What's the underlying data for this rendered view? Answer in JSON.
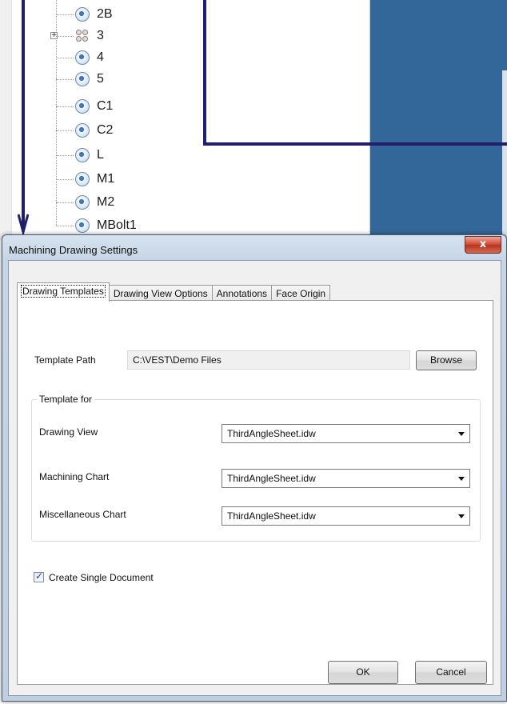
{
  "tree": {
    "items": [
      {
        "label": "2B",
        "icon": "part-node-icon"
      },
      {
        "label": "3",
        "icon": "group-node-icon",
        "expander": "+"
      },
      {
        "label": "4",
        "icon": "part-node-icon"
      },
      {
        "label": "5",
        "icon": "part-node-icon"
      },
      {
        "label": "C1",
        "icon": "part-node-icon"
      },
      {
        "label": "C2",
        "icon": "part-node-icon"
      },
      {
        "label": "L",
        "icon": "part-node-icon"
      },
      {
        "label": "M1",
        "icon": "part-node-icon"
      },
      {
        "label": "M2",
        "icon": "part-node-icon"
      },
      {
        "label": "MBolt1",
        "icon": "part-node-icon"
      }
    ]
  },
  "dialog": {
    "title": "Machining Drawing Settings",
    "close_label": "x",
    "tabs": [
      {
        "label": "Drawing Templates",
        "active": true
      },
      {
        "label": "Drawing View Options",
        "active": false
      },
      {
        "label": "Annotations",
        "active": false
      },
      {
        "label": "Face Origin",
        "active": false
      }
    ],
    "template_path": {
      "label": "Template Path",
      "value": "C:\\VEST\\Demo Files",
      "browse_label": "Browse"
    },
    "template_group": {
      "title": "Template for",
      "rows": [
        {
          "label": "Drawing View",
          "value": "ThirdAngleSheet.idw"
        },
        {
          "label": "Machining Chart",
          "value": "ThirdAngleSheet.idw"
        },
        {
          "label": "Miscellaneous Chart",
          "value": "ThirdAngleSheet.idw"
        }
      ]
    },
    "create_single_document": {
      "label": "Create Single Document",
      "checked": true
    },
    "ok_label": "OK",
    "cancel_label": "Cancel"
  },
  "colors": {
    "desktop_blue": "#336699",
    "annotation_navy": "#1f1f6e",
    "close_red": "#c8432b"
  }
}
